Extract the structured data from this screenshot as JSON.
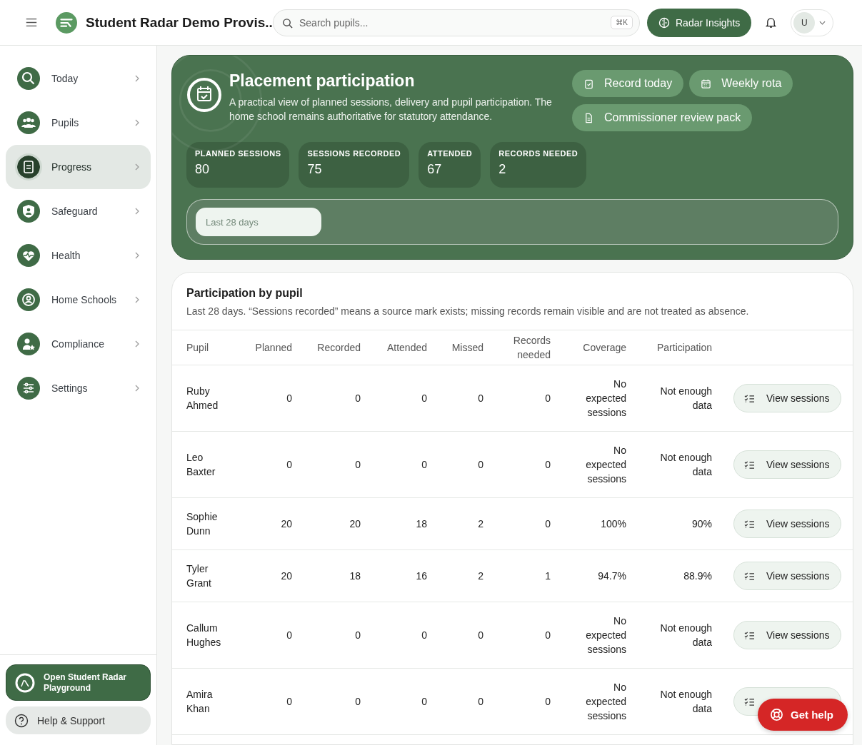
{
  "header": {
    "title": "Student Radar Demo Provis...",
    "search": {
      "placeholder": "Search pupils...",
      "shortcut": "⌘K"
    },
    "insights_button": "Radar Insights",
    "avatar": "U"
  },
  "sidebar": {
    "items": [
      {
        "label": "Today",
        "selected": false
      },
      {
        "label": "Pupils",
        "selected": false
      },
      {
        "label": "Progress",
        "selected": true
      },
      {
        "label": "Safeguard",
        "selected": false
      },
      {
        "label": "Health",
        "selected": false
      },
      {
        "label": "Home Schools",
        "selected": false
      },
      {
        "label": "Compliance",
        "selected": false
      },
      {
        "label": "Settings",
        "selected": false
      }
    ],
    "playground_button": "Open Student Radar Playground",
    "help_button": "Help & Support"
  },
  "hero": {
    "title": "Placement participation",
    "description": "A practical view of planned sessions, delivery and pupil participation. The home school remains authoritative for statutory attendance.",
    "actions": [
      {
        "label": "Record today"
      },
      {
        "label": "Weekly rota"
      },
      {
        "label": "Commissioner review pack"
      }
    ],
    "stats": [
      {
        "label": "PLANNED SESSIONS",
        "value": "80"
      },
      {
        "label": "SESSIONS RECORDED",
        "value": "75"
      },
      {
        "label": "ATTENDED",
        "value": "67"
      },
      {
        "label": "RECORDS NEEDED",
        "value": "2"
      }
    ],
    "period_select": "Last 28 days"
  },
  "table": {
    "title": "Participation by pupil",
    "subtitle": "Last 28 days. “Sessions recorded” means a source mark exists; missing records remain visible and are not treated as absence.",
    "columns": [
      "Pupil",
      "Planned",
      "Recorded",
      "Attended",
      "Missed",
      "Records needed",
      "Coverage",
      "Participation"
    ],
    "rows": [
      {
        "cells": [
          "Ruby Ahmed",
          "0",
          "0",
          "0",
          "0",
          "0",
          "No expected sessions",
          "Not enough data"
        ],
        "action": "View sessions"
      },
      {
        "cells": [
          "Leo Baxter",
          "0",
          "0",
          "0",
          "0",
          "0",
          "No expected sessions",
          "Not enough data"
        ],
        "action": "View sessions"
      },
      {
        "cells": [
          "Sophie Dunn",
          "20",
          "20",
          "18",
          "2",
          "0",
          "100%",
          "90%"
        ],
        "action": "View sessions"
      },
      {
        "cells": [
          "Tyler Grant",
          "20",
          "18",
          "16",
          "2",
          "1",
          "94.7%",
          "88.9%"
        ],
        "action": "View sessions"
      },
      {
        "cells": [
          "Callum Hughes",
          "0",
          "0",
          "0",
          "0",
          "0",
          "No expected sessions",
          "Not enough data"
        ],
        "action": "View sessions"
      },
      {
        "cells": [
          "Amira Khan",
          "0",
          "0",
          "0",
          "0",
          "0",
          "No expected sessions",
          "Not enough data"
        ]
      }
    ]
  },
  "help_fab": "Get help"
}
